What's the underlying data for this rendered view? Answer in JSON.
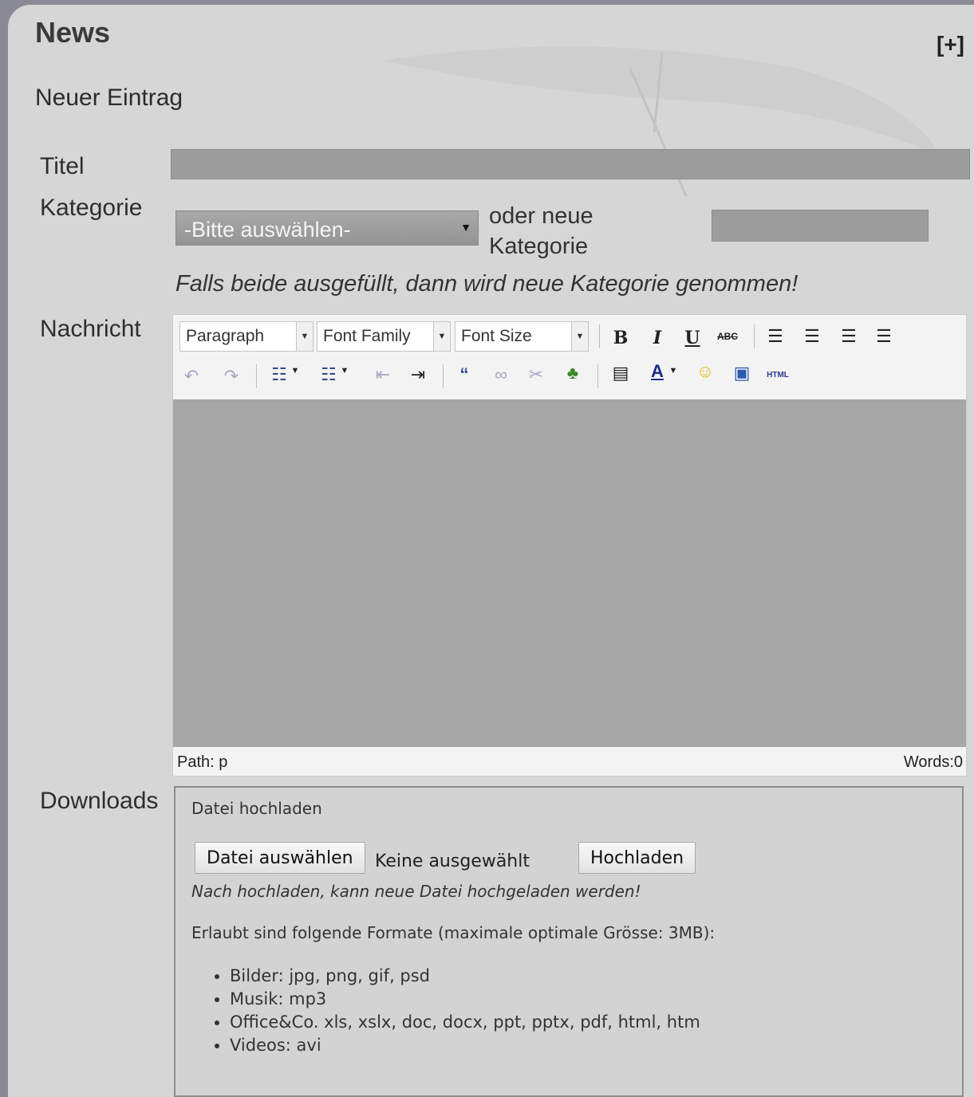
{
  "page": {
    "title": "News",
    "expand_label": "[+]",
    "subheading": "Neuer Eintrag"
  },
  "form": {
    "title_label": "Titel",
    "title_value": "",
    "category_label": "Kategorie",
    "category_selected": "-Bitte auswählen-",
    "new_category_label_line1": "oder neue",
    "new_category_label_line2": "Kategorie",
    "new_category_value": "",
    "category_hint": "Falls beide ausgefüllt, dann wird neue Kategorie genommen!",
    "message_label": "Nachricht",
    "downloads_label": "Downloads"
  },
  "editor": {
    "format_select": "Paragraph",
    "font_family_select": "Font Family",
    "font_size_select": "Font Size",
    "bold": "B",
    "italic": "I",
    "underline": "U",
    "strikethrough": "ABC",
    "html_button": "HTML",
    "path": "Path: p",
    "word_count": "Words:0",
    "icons": [
      "undo-icon",
      "redo-icon",
      "bullet-list-icon",
      "numbered-list-icon",
      "outdent-icon",
      "indent-icon",
      "blockquote-icon",
      "link-icon",
      "unlink-icon",
      "image-icon",
      "media-icon",
      "text-color-icon",
      "emoticon-icon",
      "template-icon"
    ]
  },
  "upload": {
    "legend": "Datei hochladen",
    "choose_button": "Datei auswählen",
    "no_file": "Keine ausgewählt",
    "upload_button": "Hochladen",
    "note": "Nach hochladen, kann neue Datei hochgeladen werden!",
    "formats_heading": "Erlaubt sind folgende Formate (maximale optimale Grösse: 3MB):",
    "formats": [
      "Bilder: jpg, png, gif, psd",
      "Musik: mp3",
      "Office&Co. xls, xslx, doc, docx, ppt, pptx, pdf, html, htm",
      "Videos: avi"
    ]
  },
  "colors": {
    "panel_bg": "#d6d6d6",
    "input_bg": "#9c9c9c",
    "editor_area": "#a6a6a6"
  }
}
